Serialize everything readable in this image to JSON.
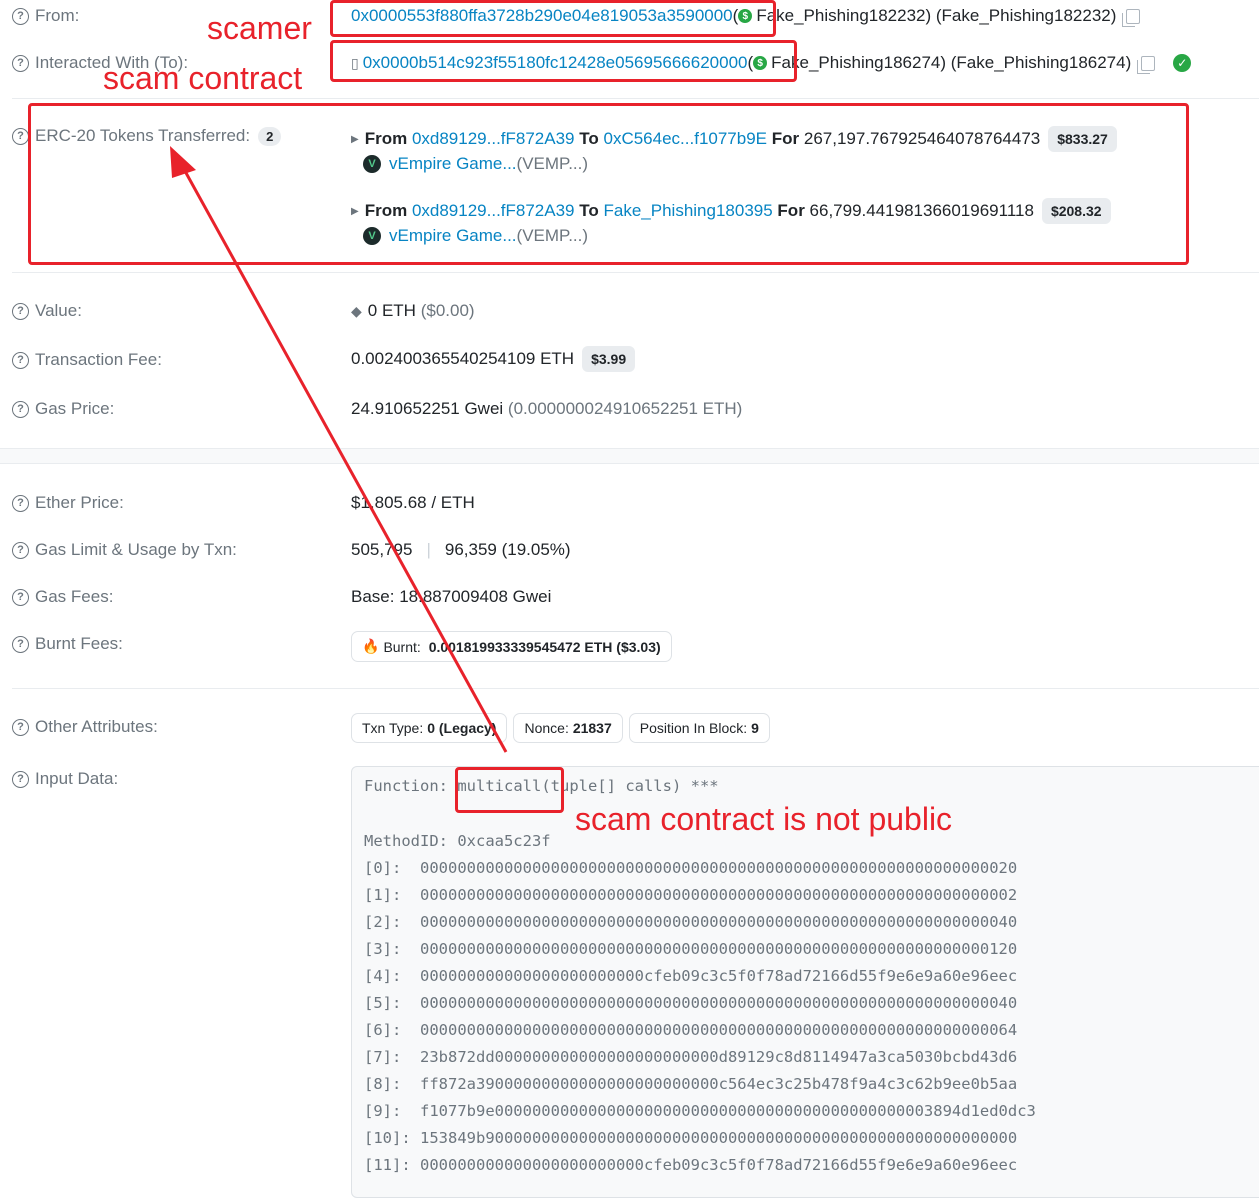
{
  "from": {
    "label": "From:",
    "address": "0x0000553f880ffa3728b290e04e819053a3590000",
    "paren_open": "(",
    "name": "Fake_Phishing182232) (Fake_Phishing182232)"
  },
  "to": {
    "label": "Interacted With (To):",
    "address": "0x0000b514c923f55180fc12428e05695666620000",
    "paren_open": "(",
    "name": "Fake_Phishing186274) (Fake_Phishing186274)"
  },
  "tokens": {
    "label": "ERC-20 Tokens Transferred:",
    "count": "2",
    "transfers": [
      {
        "from_word": "From",
        "from": "0xd89129...fF872A39",
        "to_word": "To",
        "to": "0xC564ec...f1077b9E",
        "for_word": "For",
        "amount": "267,197.767925464078764473",
        "usd": "$833.27",
        "token": "vEmpire Game...",
        "symbol": "(VEMP...)"
      },
      {
        "from_word": "From",
        "from": "0xd89129...fF872A39",
        "to_word": "To",
        "to": "Fake_Phishing180395",
        "for_word": "For",
        "amount": "66,799.441981366019691118",
        "usd": "$208.32",
        "token": "vEmpire Game...",
        "symbol": "(VEMP...)"
      }
    ]
  },
  "value": {
    "label": "Value:",
    "amount": "0 ETH",
    "usd": "($0.00)"
  },
  "fee": {
    "label": "Transaction Fee:",
    "amount": "0.002400365540254109 ETH",
    "usd": "$3.99"
  },
  "gas_price": {
    "label": "Gas Price:",
    "gwei": "24.910652251 Gwei",
    "eth": "(0.000000024910652251 ETH)"
  },
  "ether_price": {
    "label": "Ether Price:",
    "value": "$1,805.68 / ETH"
  },
  "gas_limit": {
    "label": "Gas Limit & Usage by Txn:",
    "limit": "505,795",
    "sep": "|",
    "usage": "96,359 (19.05%)"
  },
  "gas_fees": {
    "label": "Gas Fees:",
    "value": "Base: 18.887009408 Gwei"
  },
  "burnt": {
    "label": "Burnt Fees:",
    "prefix": "Burnt:",
    "value": "0.001819933339545472 ETH ($3.03)"
  },
  "other": {
    "label": "Other Attributes:",
    "pills": [
      {
        "key": "Txn Type:",
        "value": "0 (Legacy)"
      },
      {
        "key": "Nonce:",
        "value": "21837"
      },
      {
        "key": "Position In Block:",
        "value": "9"
      }
    ]
  },
  "input": {
    "label": "Input Data:",
    "function_prefix": "Function: ",
    "function_name": "multicall",
    "function_rest": "(tuple[] calls) ***",
    "method_id": "MethodID: 0xcaa5c23f",
    "lines": [
      "[0]:  0000000000000000000000000000000000000000000000000000000000000020",
      "[1]:  0000000000000000000000000000000000000000000000000000000000000002",
      "[2]:  0000000000000000000000000000000000000000000000000000000000000040",
      "[3]:  0000000000000000000000000000000000000000000000000000000000000120",
      "[4]:  000000000000000000000000cfeb09c3c5f0f78ad72166d55f9e6e9a60e96eec",
      "[5]:  0000000000000000000000000000000000000000000000000000000000000040",
      "[6]:  0000000000000000000000000000000000000000000000000000000000000064",
      "[7]:  23b872dd000000000000000000000000d89129c8d8114947a3ca5030bcbd43d6",
      "[8]:  ff872a39000000000000000000000000c564ec3c25b478f9a4c3c62b9ee0b5aa",
      "[9]:  f1077b9e00000000000000000000000000000000000000000000003894d1ed0dc3",
      "[10]: 153849b900000000000000000000000000000000000000000000000000000000",
      "[11]: 000000000000000000000000cfeb09c3c5f0f78ad72166d55f9e6e9a60e96eec"
    ]
  },
  "annotations": {
    "scamer": "scamer",
    "scam_contract": "scam contract",
    "not_public": "scam contract is not public"
  },
  "colors": {
    "annotation": "#e8222b",
    "link": "#0784c3",
    "success": "#28a745"
  }
}
